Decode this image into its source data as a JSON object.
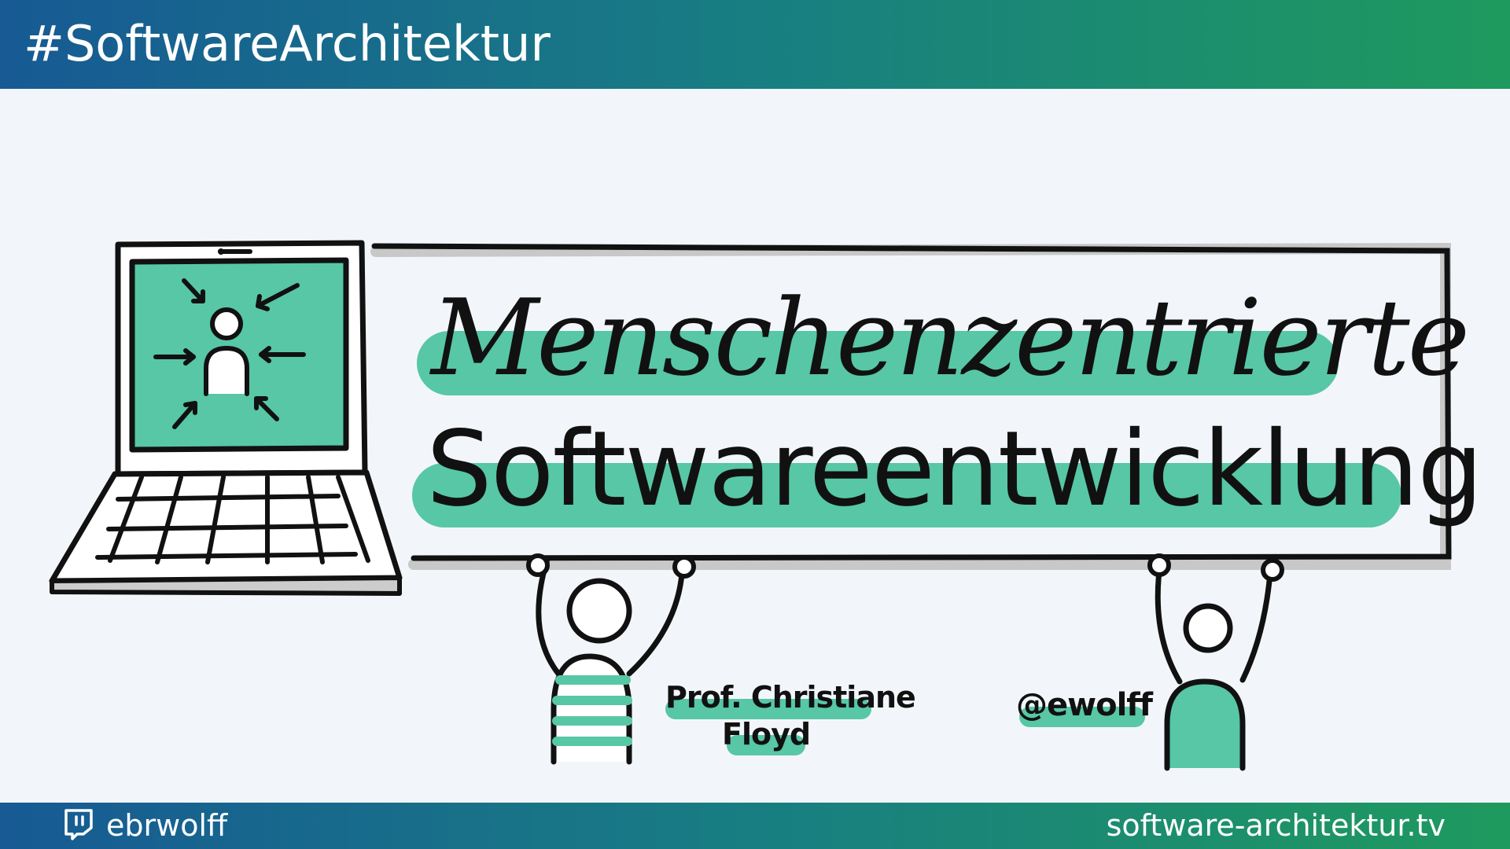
{
  "header": {
    "title": "#SoftwareArchitektur"
  },
  "illustration": {
    "title_line1": "Menschenzentrierte",
    "title_line2": "Softwareentwicklung",
    "person_left_label_line1": "Prof. Christiane",
    "person_left_label_line2": "Floyd",
    "person_right_label": "@ewolff",
    "icons": [
      "laptop-icon",
      "person-focus-icon",
      "person-striped-icon",
      "person-icon"
    ]
  },
  "footer": {
    "twitch_handle": "ebrwolff",
    "website": "software-architektur.tv",
    "icon": "twitch-icon"
  },
  "colors": {
    "bar_gradient_start": "#175a94",
    "bar_gradient_mid": "#187e82",
    "bar_gradient_end": "#1f9a5e",
    "highlight": "#57c7a5",
    "background": "#f2f6fa",
    "ink": "#111111"
  }
}
